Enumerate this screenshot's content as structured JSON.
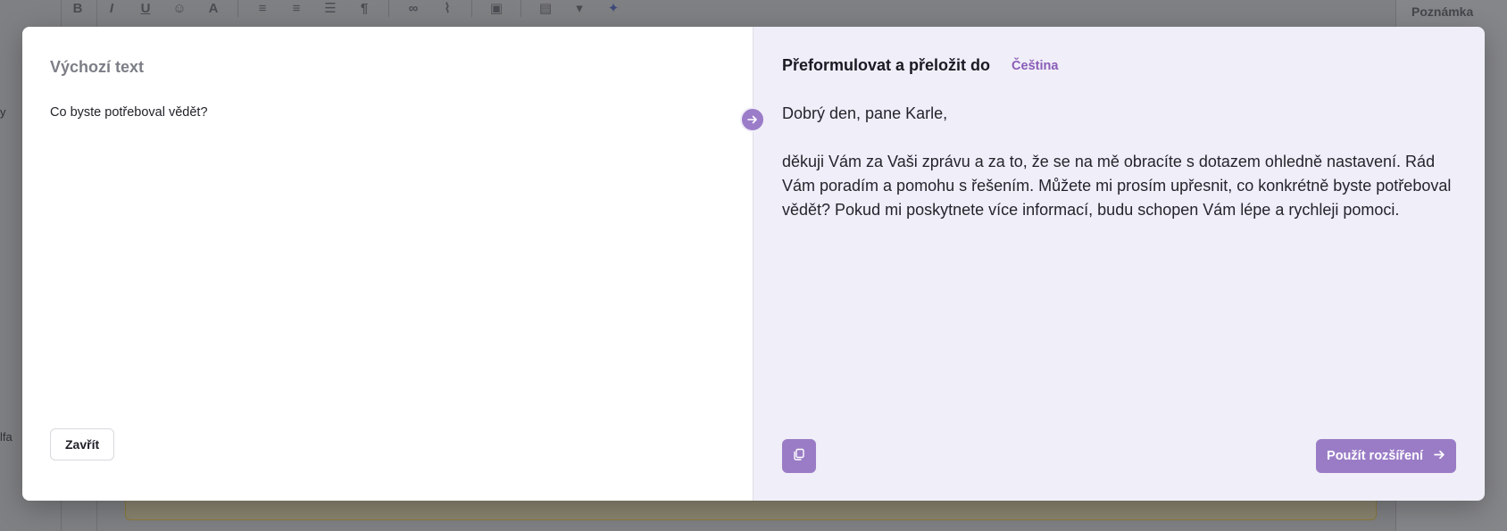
{
  "background": {
    "toolbar_icons": [
      "bold-icon",
      "italic-icon",
      "underline-icon",
      "emoji-icon",
      "text-size-icon",
      "align-left-icon",
      "align-center-icon",
      "ordered-list-icon",
      "paragraph-icon",
      "link-icon",
      "attachment-icon",
      "image-icon",
      "table-icon",
      "template-icon",
      "sparkle-icon"
    ],
    "right_panel_title": "Poznámka",
    "left_edge_text_1": "y",
    "left_edge_text_2": "lfa"
  },
  "modal": {
    "left": {
      "title": "Výchozí text",
      "source_text": "Co byste potřeboval vědět?",
      "close_label": "Zavřít"
    },
    "right": {
      "title": "Přeformulovat a přeložit do",
      "language": "Čeština",
      "result_paragraphs": [
        "Dobrý den, pane Karle,",
        "děkuji Vám za Vaši zprávu a za to, že se na mě obracíte s dotazem ohledně nastavení. Rád Vám poradím a pomohu s řešením. Můžete mi prosím upřesnit, co konkrétně byste potřeboval vědět? Pokud mi poskytnete více informací, budu schopen Vám lépe a rychleji pomoci."
      ],
      "apply_label": "Použít rozšíření"
    },
    "colors": {
      "accent": "#9a7cc6",
      "accent_text": "#8a5cb8",
      "right_pane_bg": "#f0eef8"
    }
  }
}
